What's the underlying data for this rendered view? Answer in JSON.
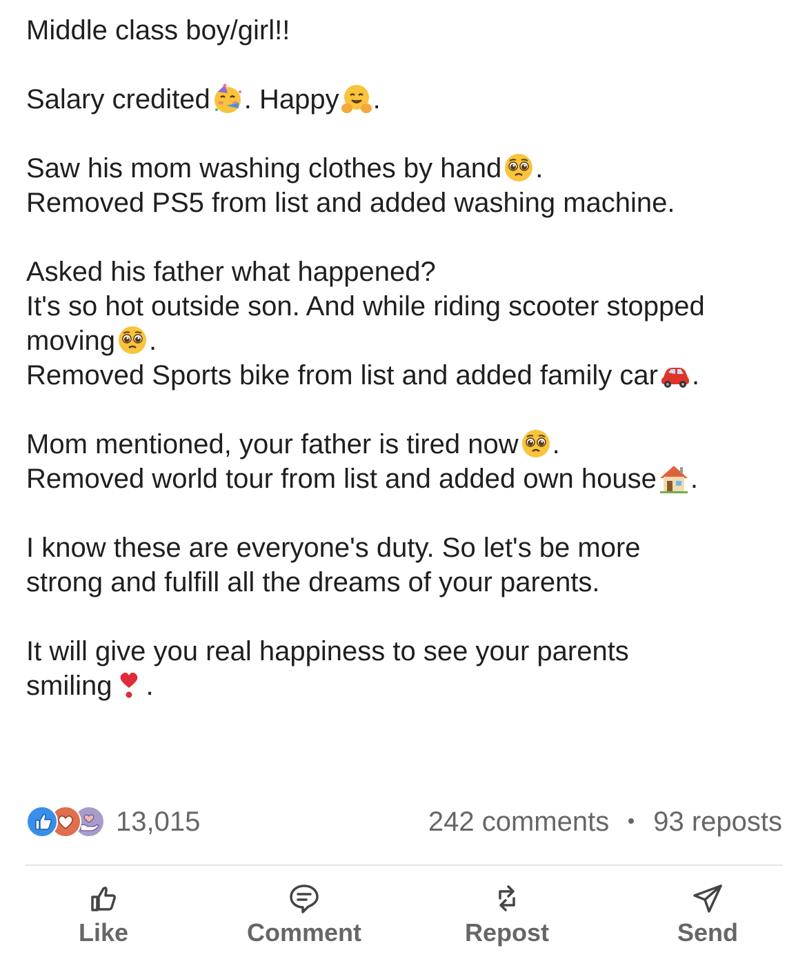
{
  "post": {
    "lines": [
      {
        "text": "Middle class boy/girl!!"
      },
      {
        "text": ""
      },
      {
        "text": "Salary credited",
        "emoji": "partying-face-icon",
        "after": ". Happy",
        "emoji2": "hugging-face-icon",
        "after2": "."
      },
      {
        "text": ""
      },
      {
        "text": "Saw his mom washing clothes by hand",
        "emoji": "pleading-face-icon",
        "after": "."
      },
      {
        "text": "Removed PS5 from list and added washing machine."
      },
      {
        "text": ""
      },
      {
        "text": "Asked his father what happened?"
      },
      {
        "text": "It's so hot outside son. And while riding scooter stopped"
      },
      {
        "text": "moving",
        "emoji": "pleading-face-icon",
        "after": "."
      },
      {
        "text": "Removed Sports bike from list and added family car",
        "emoji": "red-car-icon",
        "after": "."
      },
      {
        "text": ""
      },
      {
        "text": "Mom mentioned, your father is tired now",
        "emoji": "pleading-face-icon",
        "after": "."
      },
      {
        "text": "Removed world tour from list and added own house",
        "emoji": "house-icon",
        "after": "."
      },
      {
        "text": ""
      },
      {
        "text": "I know these are everyone's duty. So let's be more"
      },
      {
        "text": "strong and fulfill all the dreams of your parents."
      },
      {
        "text": ""
      },
      {
        "text": "It will give you real happiness to see your parents"
      },
      {
        "text": "smiling",
        "emoji": "red-exclamation-icon",
        "after": "."
      }
    ]
  },
  "social": {
    "reactions": [
      "like-reaction-icon",
      "love-reaction-icon",
      "support-reaction-icon"
    ],
    "reaction_count": "13,015",
    "comments": "242 comments",
    "reposts": "93 reposts"
  },
  "actions": {
    "like": {
      "label": "Like",
      "icon": "thumbs-up-icon"
    },
    "comment": {
      "label": "Comment",
      "icon": "speech-bubble-icon"
    },
    "repost": {
      "label": "Repost",
      "icon": "repost-arrows-icon"
    },
    "send": {
      "label": "Send",
      "icon": "paper-plane-icon"
    }
  },
  "colors": {
    "text": "#1f1f1f",
    "muted": "#666666",
    "like_blue": "#378fe9",
    "love_red": "#df704d",
    "support_purple": "#a89ccb"
  }
}
